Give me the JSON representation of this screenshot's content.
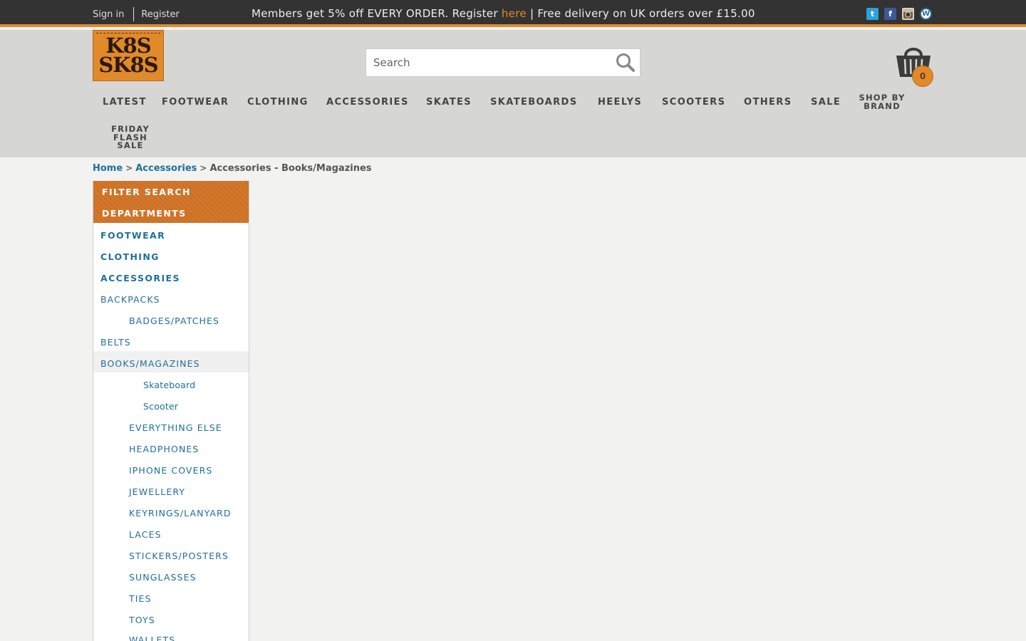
{
  "topbar": {
    "sign_in": "Sign in",
    "register": "Register",
    "promo_before": "Members get 5% off EVERY ORDER. Register ",
    "promo_link": "here",
    "promo_after": " | Free delivery on UK orders over £15.00",
    "social": [
      {
        "icon": "twitter-icon",
        "glyph": "t"
      },
      {
        "icon": "facebook-icon",
        "glyph": "f"
      },
      {
        "icon": "instagram-icon",
        "glyph": "◙"
      },
      {
        "icon": "wordpress-icon",
        "glyph": "W"
      }
    ]
  },
  "logo": {
    "line1": "K8S",
    "line2": "SK8S"
  },
  "search": {
    "placeholder": "Search"
  },
  "basket": {
    "count": "0"
  },
  "nav": {
    "latest": "LATEST",
    "footwear": "FOOTWEAR",
    "clothing": "CLOTHING",
    "accessories": "ACCESSORIES",
    "skates": "SKATES",
    "skateboards": "SKATEBOARDS",
    "heelys": "HEELYS",
    "scooters": "SCOOTERS",
    "others": "OTHERS",
    "sale": "SALE",
    "shop_by_1": "SHOP BY",
    "shop_by_2": "BRAND",
    "friday_1": "FRIDAY",
    "friday_2": "FLASH",
    "friday_3": "SALE"
  },
  "breadcrumb": {
    "home": "Home",
    "accessories": "Accessories",
    "current": "Accessories - Books/Magazines",
    "separator": ">"
  },
  "sidebar": {
    "filter_search": "FILTER SEARCH",
    "departments": "DEPARTMENTS",
    "footwear": "FOOTWEAR",
    "clothing": "CLOTHING",
    "accessories": "ACCESSORIES",
    "backpacks": "BACKPACKS",
    "badges": "BADGES/PATCHES",
    "belts": "BELTS",
    "books": "BOOKS/MAGAZINES",
    "skateboard": "Skateboard",
    "scooter": "Scooter",
    "everything_else": "EVERYTHING ELSE",
    "headphones": "HEADPHONES",
    "iphone_covers": "IPHONE COVERS",
    "jewellery": "JEWELLERY",
    "keyrings": "KEYRINGS/LANYARD",
    "laces": "LACES",
    "stickers": "STICKERS/POSTERS",
    "sunglasses": "SUNGLASSES",
    "ties": "TIES",
    "toys": "TOYS",
    "wallets": "WALLETS"
  },
  "colors": {
    "accent": "#e08a2c",
    "topbar": "#333333",
    "header": "#d6d6d4",
    "link": "#1f6fa0"
  }
}
